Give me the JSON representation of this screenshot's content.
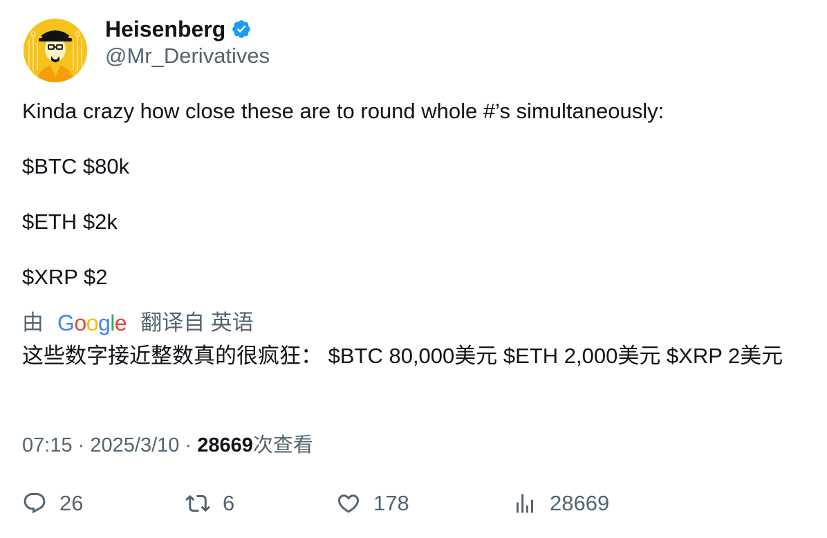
{
  "author": {
    "display_name": "Heisenberg",
    "handle": "@Mr_Derivatives",
    "verified": true,
    "verified_color": "#1d9bf0",
    "avatar_bg": "#f6c31d"
  },
  "tweet": {
    "text": "Kinda crazy how close these are to round whole #’s simultaneously:\n\n$BTC $80k\n\n$ETH $2k\n\n$XRP $2"
  },
  "translation": {
    "by_label": "由",
    "provider": "Google",
    "translated_from_label": "翻译自 英语",
    "text": "这些数字接近整数真的很疯狂： $BTC 80,000美元 $ETH 2,000美元 $XRP 2美元"
  },
  "meta": {
    "time": "07:15",
    "separator": "·",
    "date": "2025/3/10",
    "views_count": "28669",
    "views_label": "次查看"
  },
  "actions": {
    "replies": "26",
    "retweets": "6",
    "likes": "178",
    "views": "28669"
  },
  "icons": {
    "reply": "reply-icon",
    "retweet": "retweet-icon",
    "like": "heart-icon",
    "views": "analytics-icon"
  }
}
